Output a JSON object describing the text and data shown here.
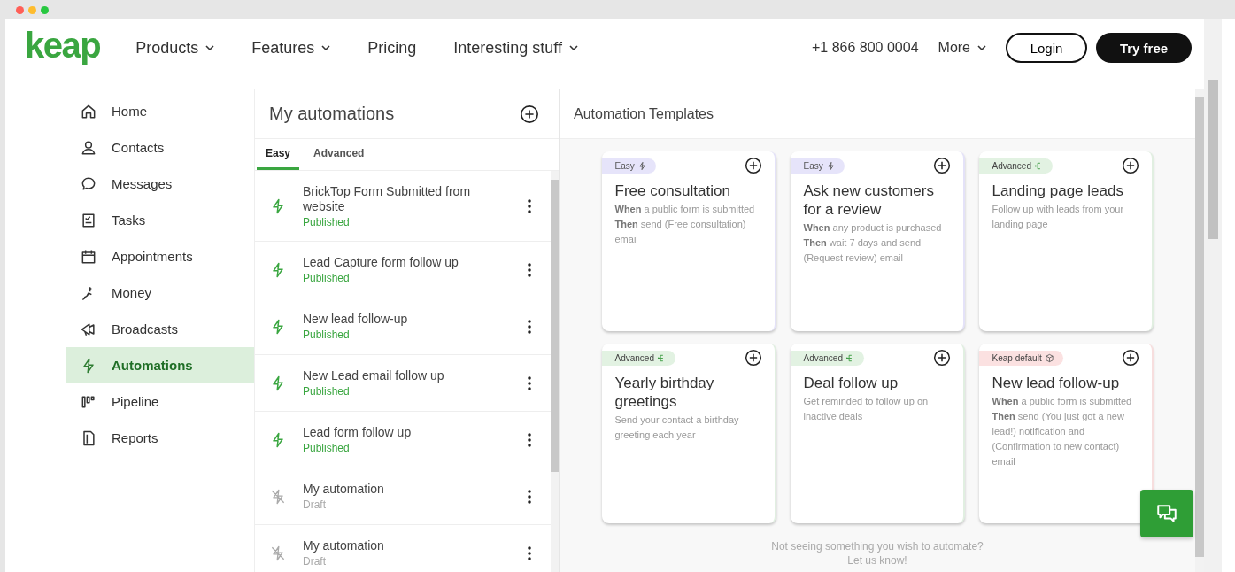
{
  "nav": {
    "logo": "keap",
    "links": [
      {
        "label": "Products",
        "dropdown": true
      },
      {
        "label": "Features",
        "dropdown": true
      },
      {
        "label": "Pricing",
        "dropdown": false
      },
      {
        "label": "Interesting stuff",
        "dropdown": true
      }
    ],
    "phone": "+1 866 800 0004",
    "more": "More",
    "login": "Login",
    "try_free": "Try free"
  },
  "sidebar": {
    "items": [
      {
        "label": "Home",
        "selected": false
      },
      {
        "label": "Contacts",
        "selected": false
      },
      {
        "label": "Messages",
        "selected": false
      },
      {
        "label": "Tasks",
        "selected": false
      },
      {
        "label": "Appointments",
        "selected": false
      },
      {
        "label": "Money",
        "selected": false
      },
      {
        "label": "Broadcasts",
        "selected": false
      },
      {
        "label": "Automations",
        "selected": true
      },
      {
        "label": "Pipeline",
        "selected": false
      },
      {
        "label": "Reports",
        "selected": false
      }
    ]
  },
  "automations": {
    "title": "My automations",
    "tabs": [
      {
        "label": "Easy",
        "selected": true
      },
      {
        "label": "Advanced",
        "selected": false
      }
    ],
    "items": [
      {
        "name": "BrickTop Form Submitted from website",
        "status": "Published",
        "kind": "published"
      },
      {
        "name": "Lead Capture form follow up",
        "status": "Published",
        "kind": "published"
      },
      {
        "name": "New lead follow-up",
        "status": "Published",
        "kind": "published"
      },
      {
        "name": "New Lead email follow up",
        "status": "Published",
        "kind": "published"
      },
      {
        "name": "Lead form follow up",
        "status": "Published",
        "kind": "published"
      },
      {
        "name": "My automation",
        "status": "Draft",
        "kind": "draft"
      },
      {
        "name": "My automation",
        "status": "Draft",
        "kind": "draft"
      }
    ]
  },
  "templates": {
    "title": "Automation Templates",
    "cards": [
      {
        "badge": "Easy",
        "kind": "easy",
        "title": "Free consultation",
        "lines": [
          "**When** a public form is submitted",
          "**Then** send (Free consultation) email"
        ]
      },
      {
        "badge": "Easy",
        "kind": "easy",
        "title": "Ask new customers for a review",
        "lines": [
          "**When** any product is purchased",
          "**Then** wait 7 days and send (Request review) email"
        ]
      },
      {
        "badge": "Advanced",
        "kind": "advanced",
        "title": "Landing page leads",
        "lines": [
          "Follow up with leads from your landing page"
        ]
      },
      {
        "badge": "Advanced",
        "kind": "advanced",
        "title": "Yearly birthday greetings",
        "lines": [
          "Send your contact a birthday greeting each year"
        ]
      },
      {
        "badge": "Advanced",
        "kind": "advanced",
        "title": "Deal follow up",
        "lines": [
          "Get reminded to follow up on inactive deals"
        ]
      },
      {
        "badge": "Keap default",
        "kind": "default",
        "title": "New lead follow-up",
        "lines": [
          "**When** a public form is submitted",
          "**Then** send (You just got a new lead!) notification and (Confirmation to new contact) email"
        ]
      }
    ],
    "footer": [
      "Not seeing something you wish to automate?",
      "Let us know!"
    ]
  }
}
